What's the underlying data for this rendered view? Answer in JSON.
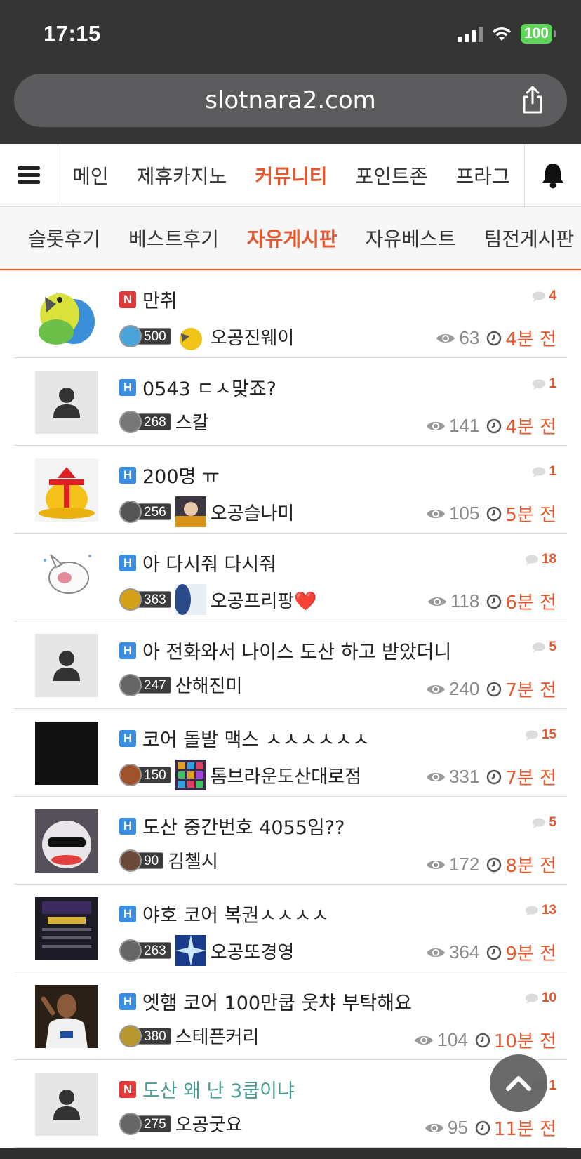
{
  "status": {
    "time": "17:15",
    "battery": "100"
  },
  "browser": {
    "url": "slotnara2.com"
  },
  "colors": {
    "accent": "#e5582f",
    "notice_badge": "#e03a3a",
    "post_badge": "#3a8de0",
    "battery": "#5fd35a"
  },
  "main_nav": {
    "items": [
      "메인",
      "제휴카지노",
      "커뮤니티",
      "포인트존",
      "프라그"
    ],
    "active": "커뮤니티"
  },
  "sub_nav": {
    "items": [
      "슬롯후기",
      "베스트후기",
      "자유게시판",
      "자유베스트",
      "팀전게시판"
    ],
    "active": "자유게시판"
  },
  "posts": [
    {
      "badge": "N",
      "title": "만취",
      "comments": "4",
      "level": "500",
      "author": "오공진웨이",
      "views": "63",
      "time": "4분 전",
      "thumb": "parrot"
    },
    {
      "badge": "H",
      "title": "0543 ㄷㅅ맞죠?",
      "comments": "1",
      "level": "268",
      "author": "스칼",
      "views": "141",
      "time": "4분 전",
      "thumb": "placeholder"
    },
    {
      "badge": "H",
      "title": "200명 ㅠ",
      "comments": "1",
      "level": "256",
      "author": "오공슬나미",
      "views": "105",
      "time": "5분 전",
      "thumb": "money-bag"
    },
    {
      "badge": "H",
      "title": "아 다시줘 다시줘",
      "comments": "18",
      "level": "363",
      "author": "오공프리팡❤️",
      "views": "118",
      "time": "6분 전",
      "thumb": "bunny"
    },
    {
      "badge": "H",
      "title": "아 전화와서 나이스 도산 하고 받았더니",
      "comments": "5",
      "level": "247",
      "author": "산해진미",
      "views": "240",
      "time": "7분 전",
      "thumb": "placeholder"
    },
    {
      "badge": "H",
      "title": "코어 돌발 맥스 ㅅㅅㅅㅅㅅㅅ",
      "comments": "15",
      "level": "150",
      "author": "톰브라운도산대로점",
      "views": "331",
      "time": "7분 전",
      "thumb": "black"
    },
    {
      "badge": "H",
      "title": "도산 중간번호 4055임??",
      "comments": "5",
      "level": "90",
      "author": "김첼시",
      "views": "172",
      "time": "8분 전",
      "thumb": "duck"
    },
    {
      "badge": "H",
      "title": "야호 코어 복권ㅅㅅㅅㅅ",
      "comments": "13",
      "level": "263",
      "author": "오공또경영",
      "views": "364",
      "time": "9분 전",
      "thumb": "screenshot"
    },
    {
      "badge": "H",
      "title": "엣햄 코어 100만쿱 웃챠 부탁해요",
      "comments": "10",
      "level": "380",
      "author": "스테픈커리",
      "views": "104",
      "time": "10분 전",
      "thumb": "player"
    },
    {
      "badge": "N",
      "title": "도산 왜 난 3쿱이냐",
      "comments": "1",
      "level": "275",
      "author": "오공굿요",
      "views": "95",
      "time": "11분 전",
      "thumb": "placeholder"
    }
  ]
}
